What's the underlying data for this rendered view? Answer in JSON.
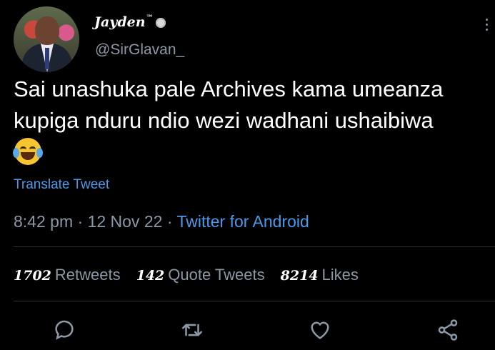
{
  "user": {
    "display_name": "Jayden",
    "display_name_mark": "™",
    "handle": "@SirGlavan_"
  },
  "tweet": {
    "text": "Sai unashuka pale Archives kama umeanza kupiga nduru ndio wezi wadhani ushaibiwa",
    "emoji": "face-with-tears-of-joy",
    "translate_label": "Translate Tweet",
    "time": "8:42 pm",
    "date": "12 Nov 22",
    "source": "Twitter for Android"
  },
  "stats": {
    "retweets_count": "1702",
    "retweets_label": "Retweets",
    "quotes_count": "142",
    "quotes_label": "Quote Tweets",
    "likes_count": "8214",
    "likes_label": "Likes"
  },
  "actions": {
    "reply_icon": "reply-icon",
    "retweet_icon": "retweet-icon",
    "like_icon": "heart-icon",
    "share_icon": "share-icon"
  },
  "colors": {
    "background": "#000000",
    "text": "#ffffff",
    "secondary": "#8b98a5",
    "link": "#4a99e9"
  }
}
